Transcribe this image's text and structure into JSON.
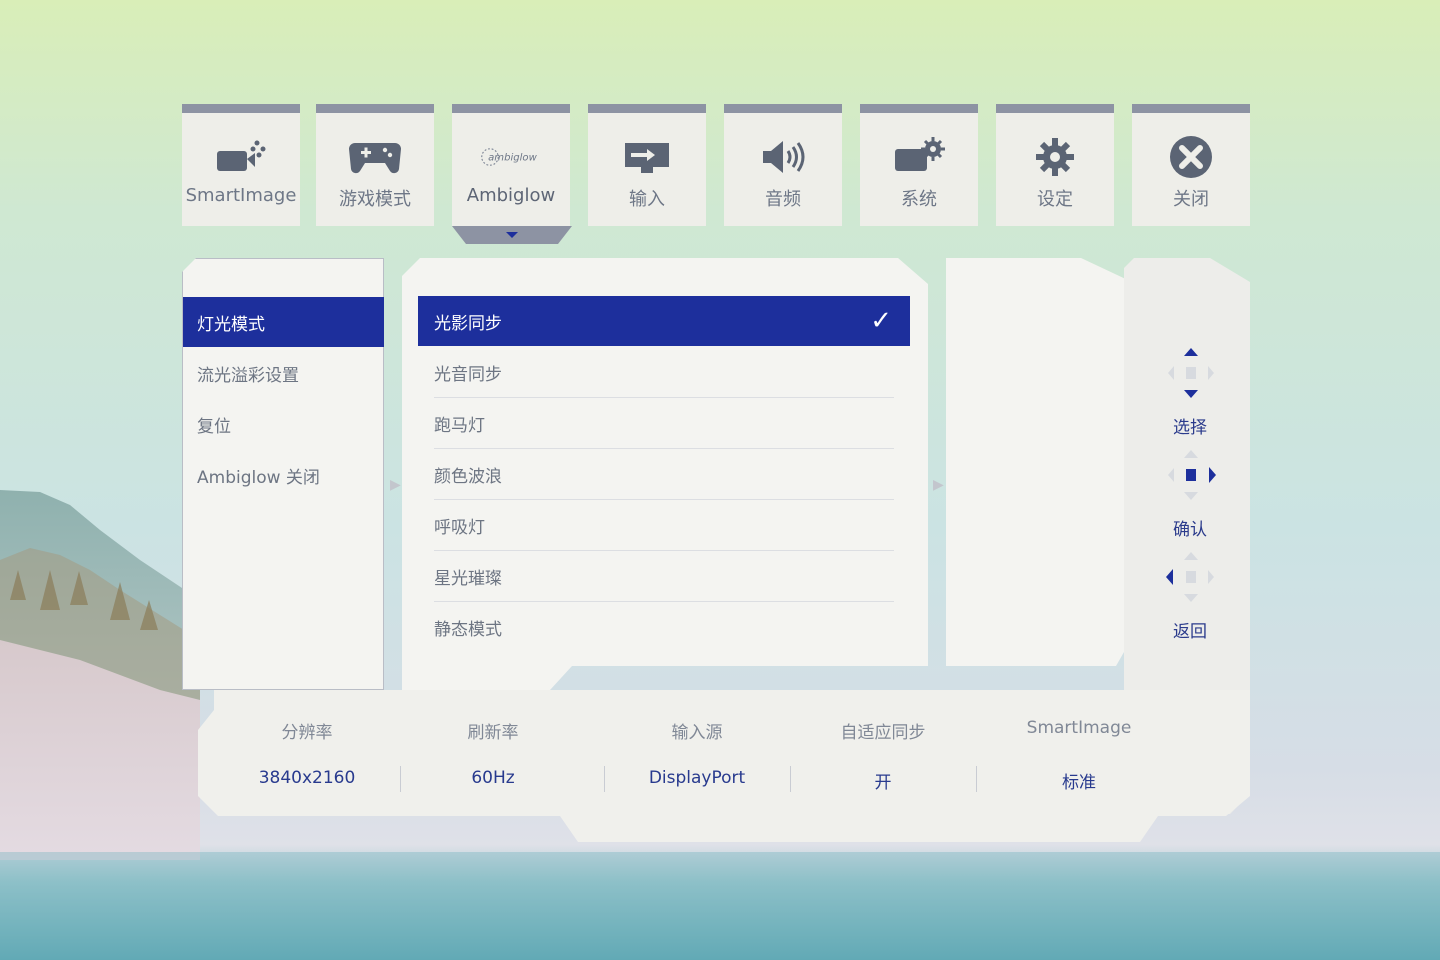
{
  "colors": {
    "accent": "#1d2f9c",
    "panel": "#f4f4f1",
    "tab_border": "#8d93a3",
    "icon": "#5b6474",
    "value_text": "#283a8e"
  },
  "tabs": [
    {
      "label": "SmartImage",
      "icon": "smartimage-icon"
    },
    {
      "label": "游戏模式",
      "icon": "gamepad-icon"
    },
    {
      "label": "Ambiglow",
      "icon": "ambiglow-logo-icon",
      "logo_text": "ambiglow"
    },
    {
      "label": "输入",
      "icon": "input-icon"
    },
    {
      "label": "音频",
      "icon": "speaker-icon"
    },
    {
      "label": "系统",
      "icon": "system-icon"
    },
    {
      "label": "设定",
      "icon": "gear-icon"
    },
    {
      "label": "关闭",
      "icon": "close-icon"
    }
  ],
  "left_menu": [
    {
      "label": "灯光模式",
      "selected": true
    },
    {
      "label": "流光溢彩设置",
      "selected": false
    },
    {
      "label": "复位",
      "selected": false
    },
    {
      "label": "Ambiglow 关闭",
      "selected": false
    }
  ],
  "mid_menu": [
    {
      "label": "光影同步",
      "selected": true
    },
    {
      "label": "光音同步",
      "selected": false
    },
    {
      "label": "跑马灯",
      "selected": false
    },
    {
      "label": "颜色波浪",
      "selected": false
    },
    {
      "label": "呼吸灯",
      "selected": false
    },
    {
      "label": "星光璀璨",
      "selected": false
    },
    {
      "label": "静态模式",
      "selected": false
    }
  ],
  "info": [
    {
      "key": "分辨率",
      "value": "3840x2160"
    },
    {
      "key": "刷新率",
      "value": "60Hz"
    },
    {
      "key": "输入源",
      "value": "DisplayPort"
    },
    {
      "key": "自适应同步",
      "value": "开"
    },
    {
      "key": "SmartImage",
      "value": "标准"
    }
  ],
  "nav": [
    {
      "label": "选择",
      "icon": "dpad-up-down-icon"
    },
    {
      "label": "确认",
      "icon": "dpad-center-right-icon"
    },
    {
      "label": "返回",
      "icon": "dpad-left-icon"
    }
  ]
}
